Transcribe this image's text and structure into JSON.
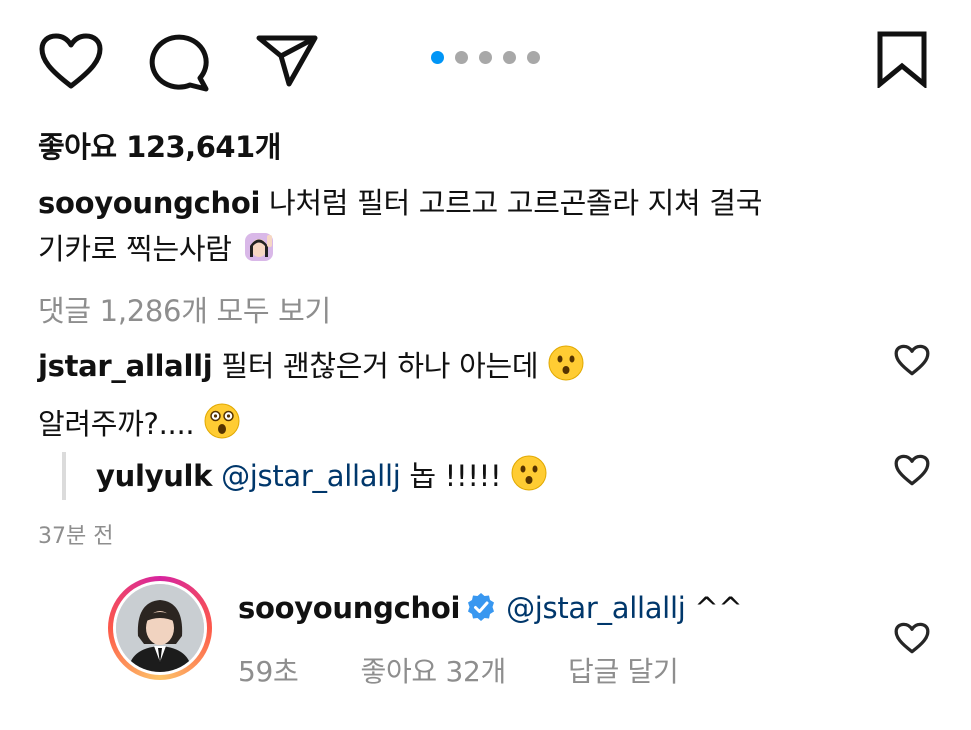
{
  "carousel": {
    "total": 5,
    "active_index": 0,
    "active_color": "#0095f6",
    "inactive_color": "#a8a8a8"
  },
  "post": {
    "likes_text": "좋아요 123,641개",
    "author": "sooyoungchoi",
    "caption_line1": "나처럼 필터 고르고 고르곤졸라 지쳐 결국",
    "caption_line2": "기카로 찍는사람",
    "view_all_comments": "댓글 1,286개 모두 보기"
  },
  "comments": [
    {
      "username": "jstar_allallj",
      "text_line1": "필터 괜찮은거 하나 아는데",
      "text_line2": "알려주까?....",
      "replies": [
        {
          "username": "yulyulk",
          "mention": "@jstar_allallj",
          "text": "놉 !!!!!"
        }
      ],
      "timestamp": "37분 전"
    }
  ],
  "owner_reply": {
    "username": "sooyoungchoi",
    "mention": "@jstar_allallj",
    "text": "^^",
    "time": "59초",
    "likes": "좋아요 32개",
    "reply_label": "답글 달기"
  },
  "icons": {
    "like": "heart-icon",
    "comment": "comment-bubble-icon",
    "share": "paper-plane-icon",
    "save": "bookmark-icon",
    "verified": "verified-badge-icon",
    "accent_blue": "#3897f0",
    "mention_color": "#00376b",
    "muted_text": "#8e8e8e"
  }
}
